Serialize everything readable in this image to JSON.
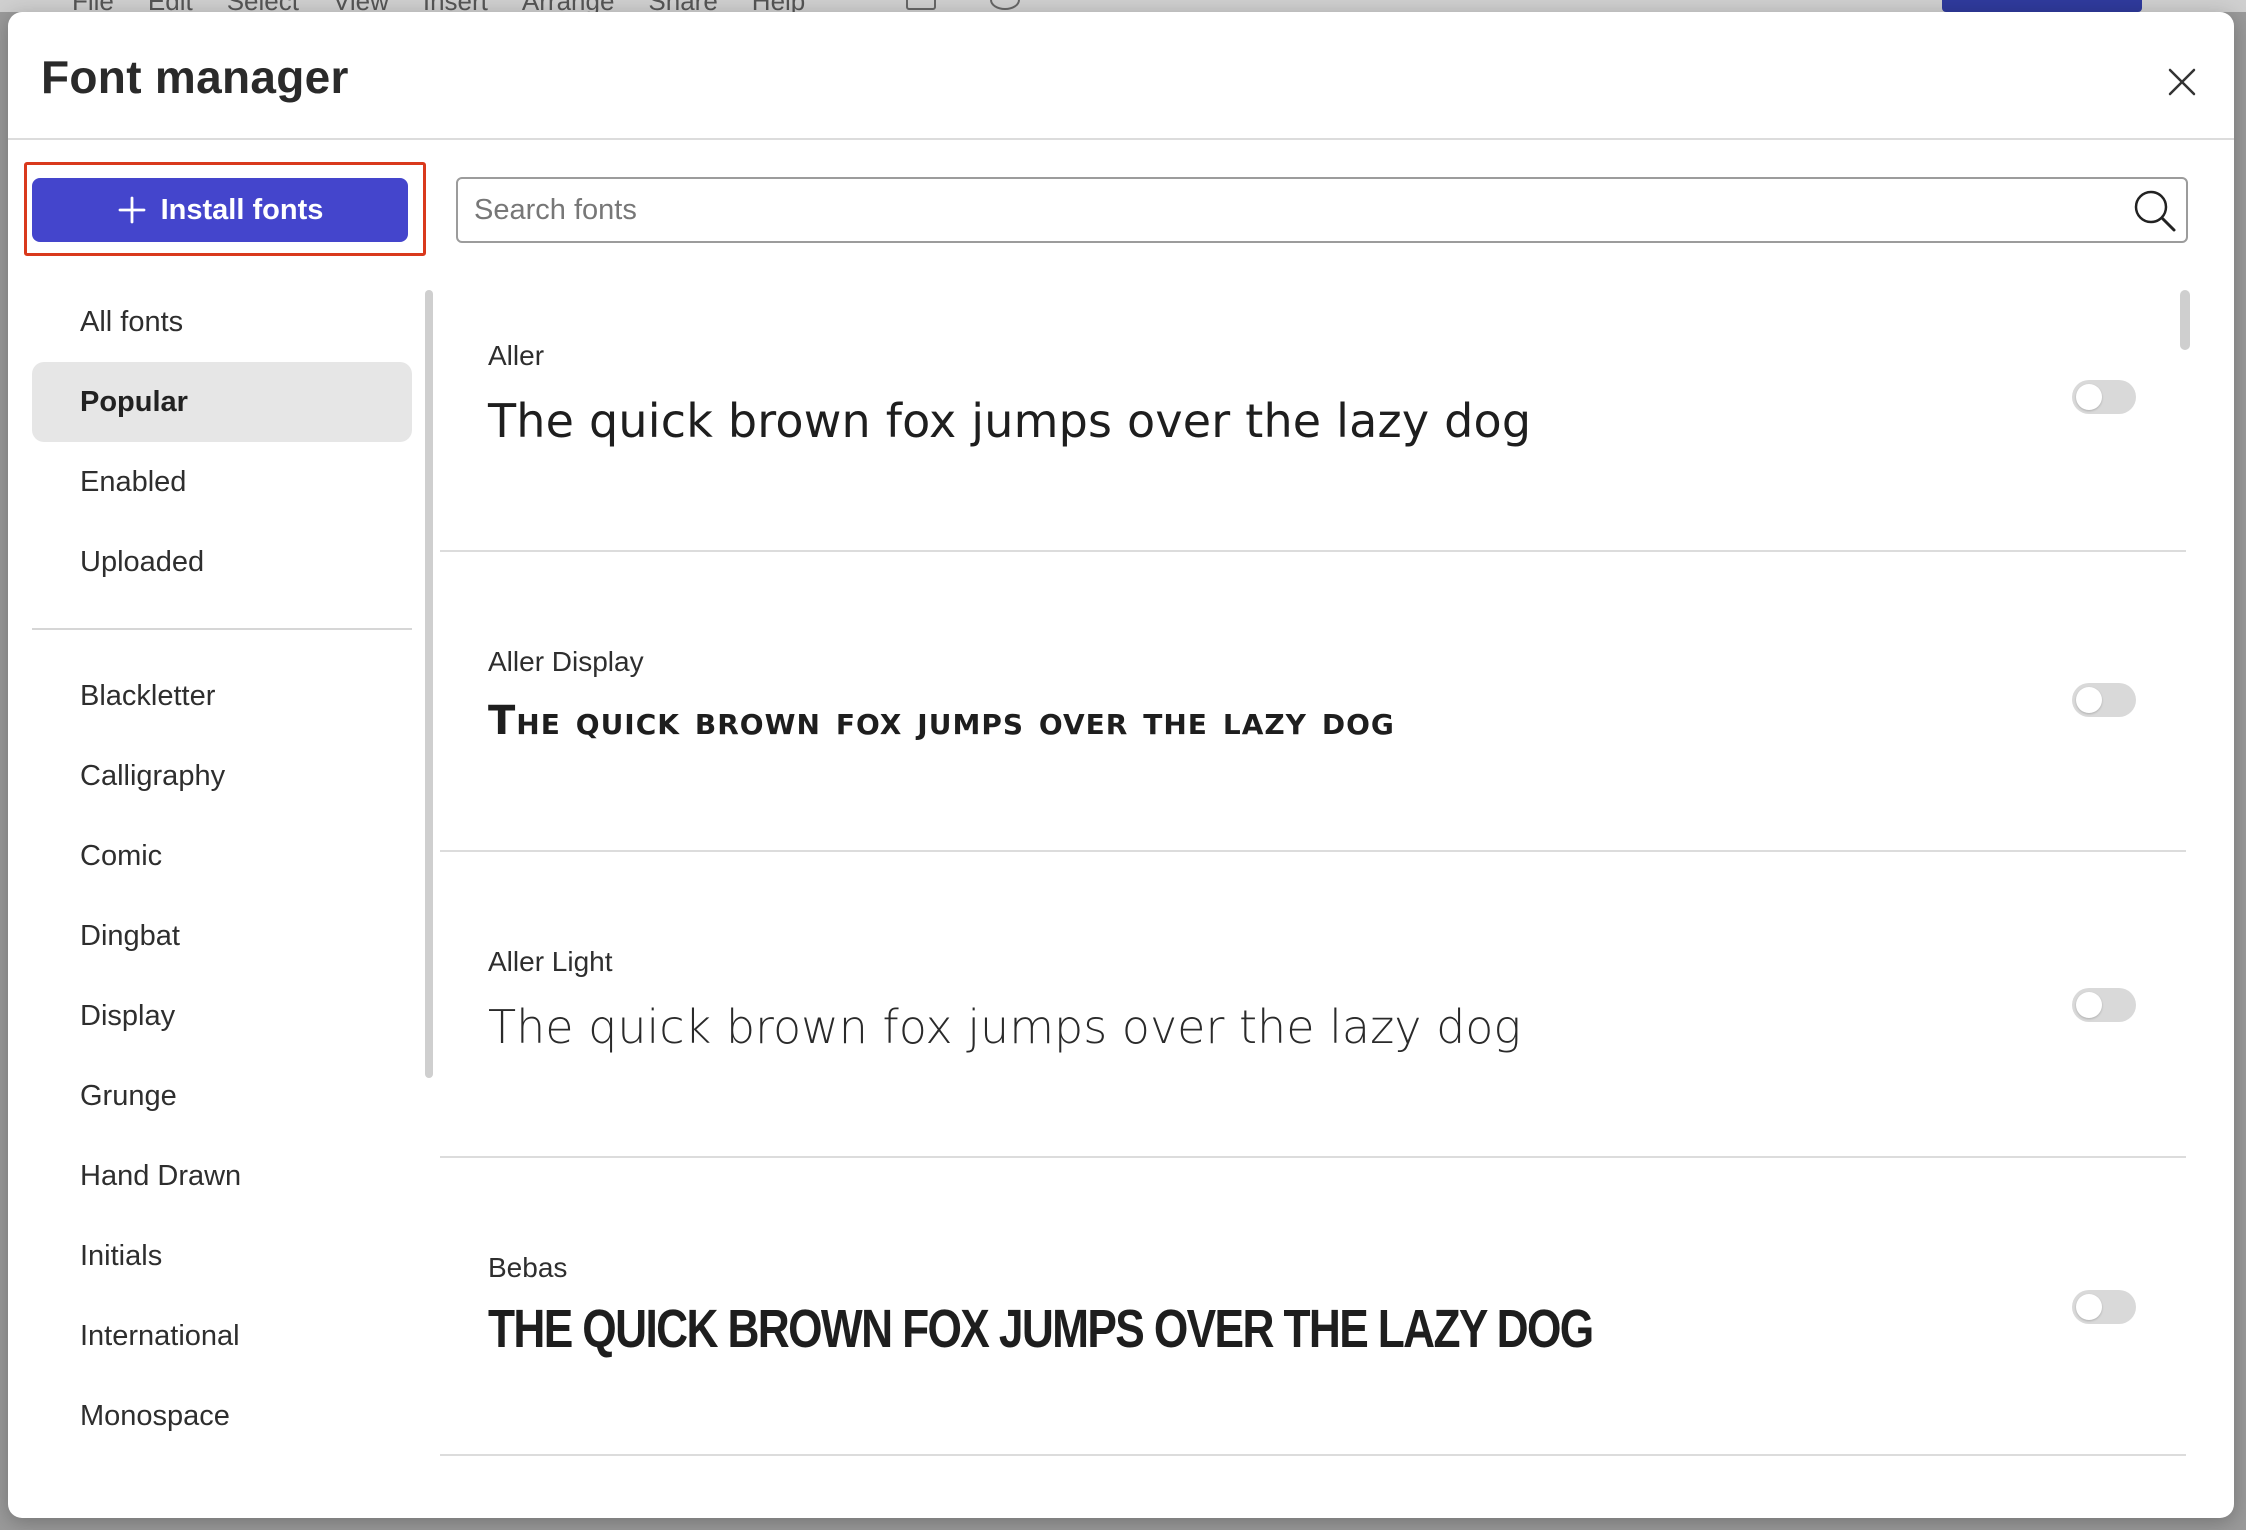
{
  "app_menu": {
    "items": [
      "File",
      "Edit",
      "Select",
      "View",
      "Insert",
      "Arrange",
      "Share",
      "Help"
    ]
  },
  "dialog": {
    "title": "Font manager",
    "close_icon": "close-icon"
  },
  "install_button": {
    "label": "Install fonts",
    "icon": "plus-icon",
    "color": "#4445cc",
    "highlight_color": "#d9391c"
  },
  "search": {
    "placeholder": "Search fonts",
    "value": "",
    "icon": "search-icon"
  },
  "sidebar": {
    "filters": [
      {
        "label": "All fonts",
        "active": false
      },
      {
        "label": "Popular",
        "active": true
      },
      {
        "label": "Enabled",
        "active": false
      },
      {
        "label": "Uploaded",
        "active": false
      }
    ],
    "categories": [
      "Blackletter",
      "Calligraphy",
      "Comic",
      "Dingbat",
      "Display",
      "Grunge",
      "Hand Drawn",
      "Initials",
      "International",
      "Monospace"
    ]
  },
  "fonts": [
    {
      "name": "Aller",
      "sample": "The quick brown fox jumps over the lazy dog",
      "enabled": false
    },
    {
      "name": "Aller Display",
      "sample": "The quick brown fox jumps over the lazy dog",
      "enabled": false
    },
    {
      "name": "Aller Light",
      "sample": "The quick brown fox jumps over the lazy dog",
      "enabled": false
    },
    {
      "name": "Bebas",
      "sample": "The quick brown fox jumps over the lazy dog",
      "enabled": false
    }
  ]
}
